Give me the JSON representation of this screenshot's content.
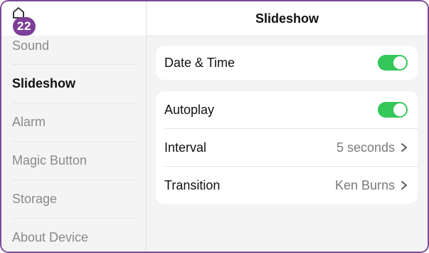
{
  "badge": {
    "count": "22"
  },
  "header": {
    "title": "Slideshow"
  },
  "sidebar": {
    "items": [
      {
        "label": "Sound"
      },
      {
        "label": "Slideshow"
      },
      {
        "label": "Alarm"
      },
      {
        "label": "Magic Button"
      },
      {
        "label": "Storage"
      },
      {
        "label": "About Device"
      }
    ],
    "active": "Slideshow"
  },
  "settings": {
    "date_time": {
      "label": "Date & Time",
      "enabled": true
    },
    "autoplay": {
      "label": "Autoplay",
      "enabled": true
    },
    "interval": {
      "label": "Interval",
      "value": "5 seconds"
    },
    "transition": {
      "label": "Transition",
      "value": "Ken Burns"
    }
  },
  "colors": {
    "accent": "#7b3f98",
    "toggle_on": "#34c759"
  },
  "icons": {
    "home": "home-icon",
    "chevron": "chevron-right-icon"
  }
}
